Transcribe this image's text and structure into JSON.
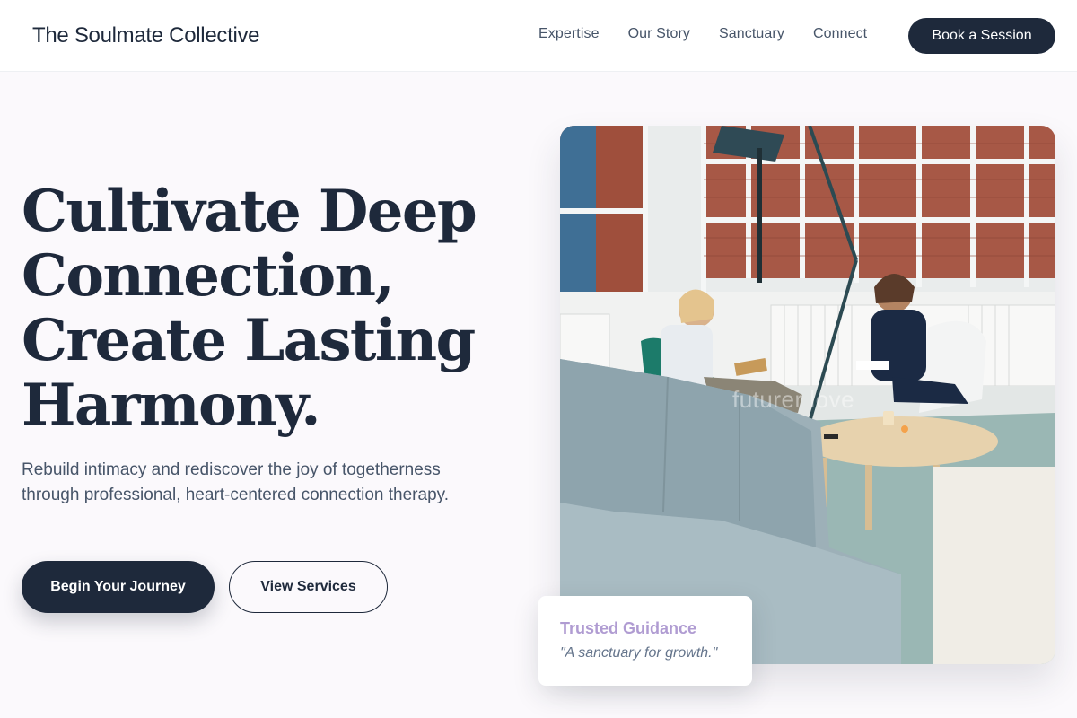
{
  "brand": {
    "name": "The Soulmate Collective"
  },
  "nav": {
    "items": [
      "Expertise",
      "Our Story",
      "Sanctuary",
      "Connect"
    ],
    "cta_label": "Book a Session"
  },
  "hero": {
    "title_lines": [
      "Cultivate Deep",
      "Connection,",
      "Create Lasting",
      "Harmony."
    ],
    "subtitle": "Rebuild intimacy and rediscover the joy of togetherness through professional, heart-centered connection therapy.",
    "primary_button": "Begin Your Journey",
    "secondary_button": "View Services"
  },
  "image": {
    "watermark": "futurer love",
    "icon": "therapy-session-photo"
  },
  "trust_card": {
    "title": "Trusted Guidance",
    "quote": "\"A sanctuary for growth.\""
  },
  "colors": {
    "navy": "#1e293b",
    "lavender": "#b09cd2",
    "background": "#fbf9fc"
  }
}
